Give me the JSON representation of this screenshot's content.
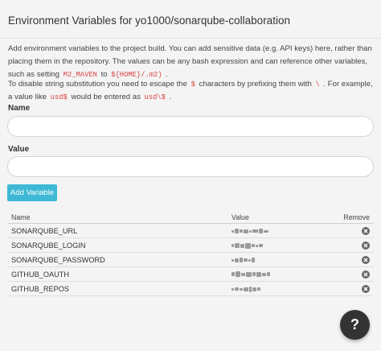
{
  "header": {
    "title": "Environment Variables for yo1000/sonarqube-collaboration"
  },
  "description": {
    "p1_a": "Add environment variables to the project build. You can add sensitive data (e.g. API keys) here, rather than placing them in the repository. The values can be any bash expression and can reference other variables, such as setting ",
    "p1_code1": "M2_MAVEN",
    "p1_b": " to ",
    "p1_code2": "${HOME}/.m2)",
    "p1_c": " .",
    "p2_a": "To disable string substitution you need to escape the ",
    "p2_code1": "$",
    "p2_b": " characters by prefixing them with ",
    "p2_code2": "\\",
    "p2_c": " . For example, a value like ",
    "p2_code3": "usd$",
    "p2_d": " would be entered as ",
    "p2_code4": "usd\\$",
    "p2_e": " ."
  },
  "form": {
    "name_label": "Name",
    "name_value": "",
    "value_label": "Value",
    "value_value": "",
    "add_button": "Add Variable"
  },
  "table": {
    "headers": {
      "name": "Name",
      "value": "Value",
      "remove": "Remove"
    },
    "rows": [
      {
        "name": "SONARQUBE_URL"
      },
      {
        "name": "SONARQUBE_LOGIN"
      },
      {
        "name": "SONARQUBE_PASSWORD"
      },
      {
        "name": "GITHUB_OAUTH"
      },
      {
        "name": "GITHUB_REPOS"
      }
    ]
  },
  "icons": {
    "remove": "close-circle-icon",
    "help": "question-icon"
  },
  "help_button": "?",
  "colors": {
    "accent": "#3eb9d5",
    "code": "#db4545",
    "help_bg": "#333333"
  }
}
